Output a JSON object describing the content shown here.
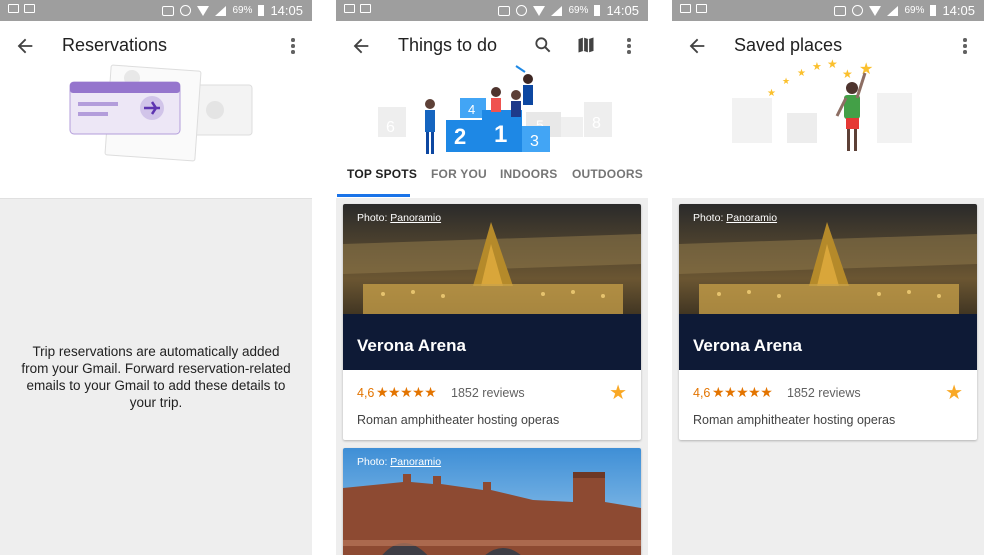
{
  "status": {
    "battery": "69%",
    "time": "14:05"
  },
  "reservations": {
    "title": "Reservations",
    "info": "Trip reservations are automatically added from your Gmail. Forward reservation-related emails to your Gmail to add these details to your trip."
  },
  "things": {
    "title": "Things to do",
    "tabs": [
      "TOP SPOTS",
      "FOR YOU",
      "INDOORS",
      "OUTDOORS"
    ],
    "podium": [
      "2",
      "1",
      "3",
      "4",
      "5",
      "6",
      "8"
    ],
    "cards": [
      {
        "credit_prefix": "Photo: ",
        "credit_link": "Panoramio",
        "name": "Verona Arena",
        "rating": "4,6",
        "stars": "★★★★★",
        "reviews": "1852 reviews",
        "description": "Roman amphitheater hosting operas"
      },
      {
        "credit_prefix": "Photo: ",
        "credit_link": "Panoramio"
      }
    ]
  },
  "saved": {
    "title": "Saved places",
    "card": {
      "credit_prefix": "Photo: ",
      "credit_link": "Panoramio",
      "name": "Verona Arena",
      "rating": "4,6",
      "stars": "★★★★★",
      "reviews": "1852 reviews",
      "description": "Roman amphitheater hosting operas"
    }
  },
  "colors": {
    "accent": "#1a73e8",
    "star": "#f9a825",
    "rating": "#e37400",
    "statusbar": "#9e9e9e"
  }
}
